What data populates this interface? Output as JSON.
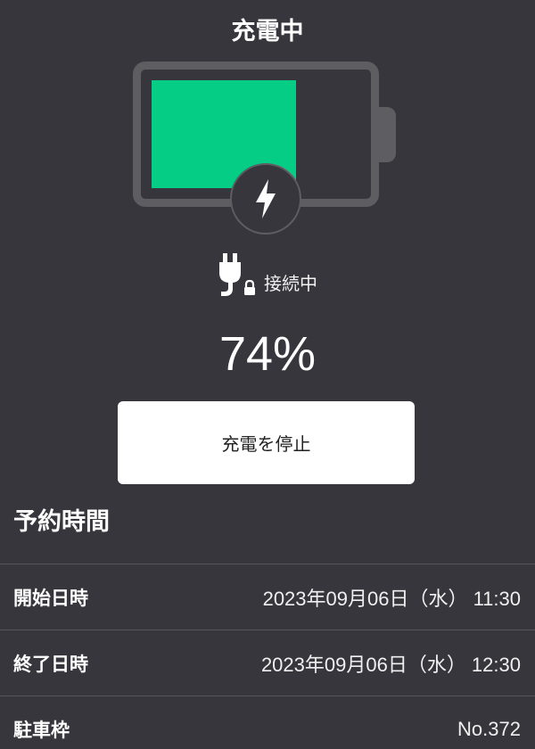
{
  "header": {
    "title": "充電中"
  },
  "battery": {
    "level_fraction": 0.6,
    "fill_color": "#05cd86",
    "frame_color": "#5e5e62"
  },
  "icons": {
    "bolt": "lightning-bolt-icon",
    "plug": "plug-icon",
    "lock": "lock-icon"
  },
  "connection": {
    "label": "接続中"
  },
  "charge": {
    "percent": "74%"
  },
  "actions": {
    "stop_label": "充電を停止"
  },
  "reservation": {
    "title": "予約時間",
    "rows": [
      {
        "label": "開始日時",
        "value": "2023年09月06日（水） 11:30"
      },
      {
        "label": "終了日時",
        "value": "2023年09月06日（水） 12:30"
      },
      {
        "label": "駐車枠",
        "value": "No.372"
      }
    ]
  }
}
